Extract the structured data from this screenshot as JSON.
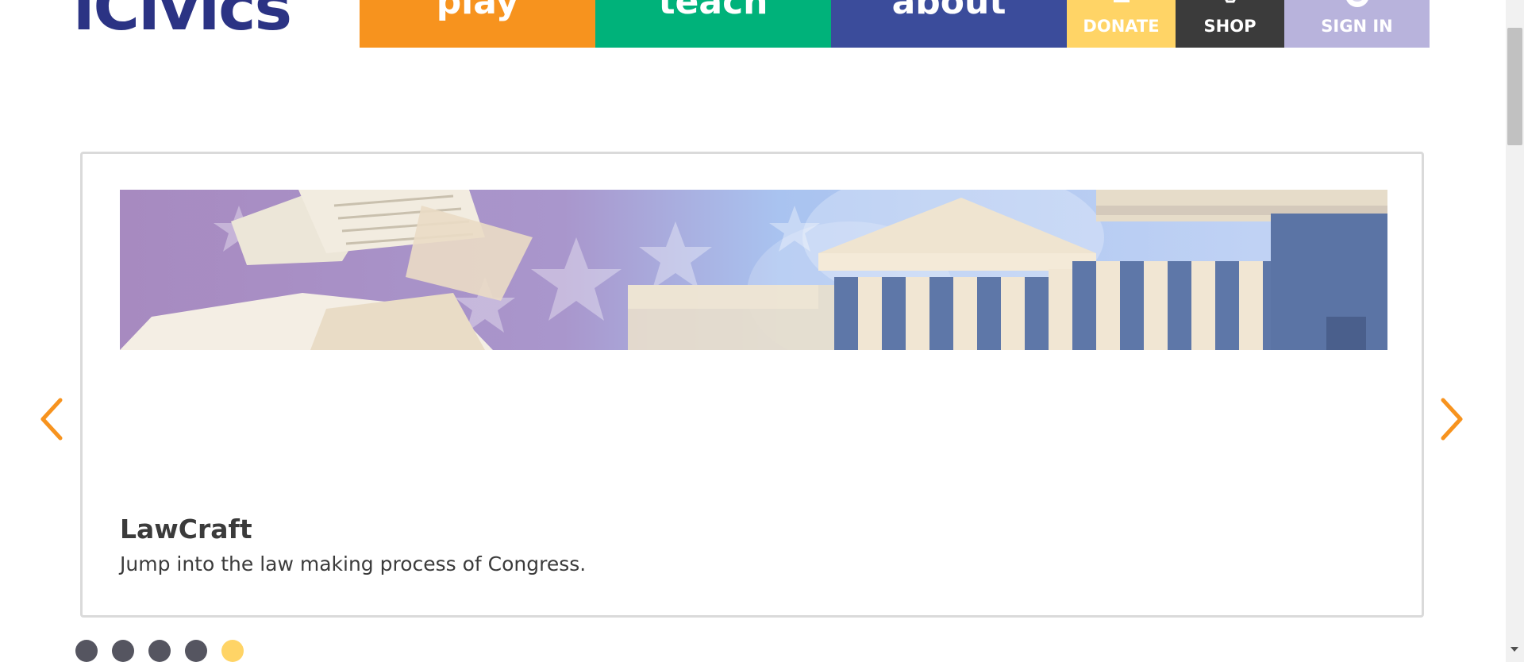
{
  "logo": {
    "text": "iCivics",
    "visible_text": "iCivics"
  },
  "nav": {
    "play": "play",
    "teach": "teach",
    "about": "about",
    "donate": "DONATE",
    "shop": "SHOP",
    "sign_in": "SIGN IN"
  },
  "colors": {
    "play": "#f7931e",
    "teach": "#00b27a",
    "about": "#3b4c9b",
    "donate": "#ffd466",
    "shop": "#3b3b3b",
    "sign_in": "#b8b3dc",
    "arrow": "#f7931e",
    "logo": "#2b3384"
  },
  "carousel": {
    "slide": {
      "title": "LawCraft",
      "description": "Jump into the law making process of Congress."
    },
    "dots": [
      {
        "active": false
      },
      {
        "active": false
      },
      {
        "active": false
      },
      {
        "active": false
      },
      {
        "active": true
      }
    ],
    "icons": {
      "prev": "chevron-left-icon",
      "next": "chevron-right-icon"
    }
  }
}
